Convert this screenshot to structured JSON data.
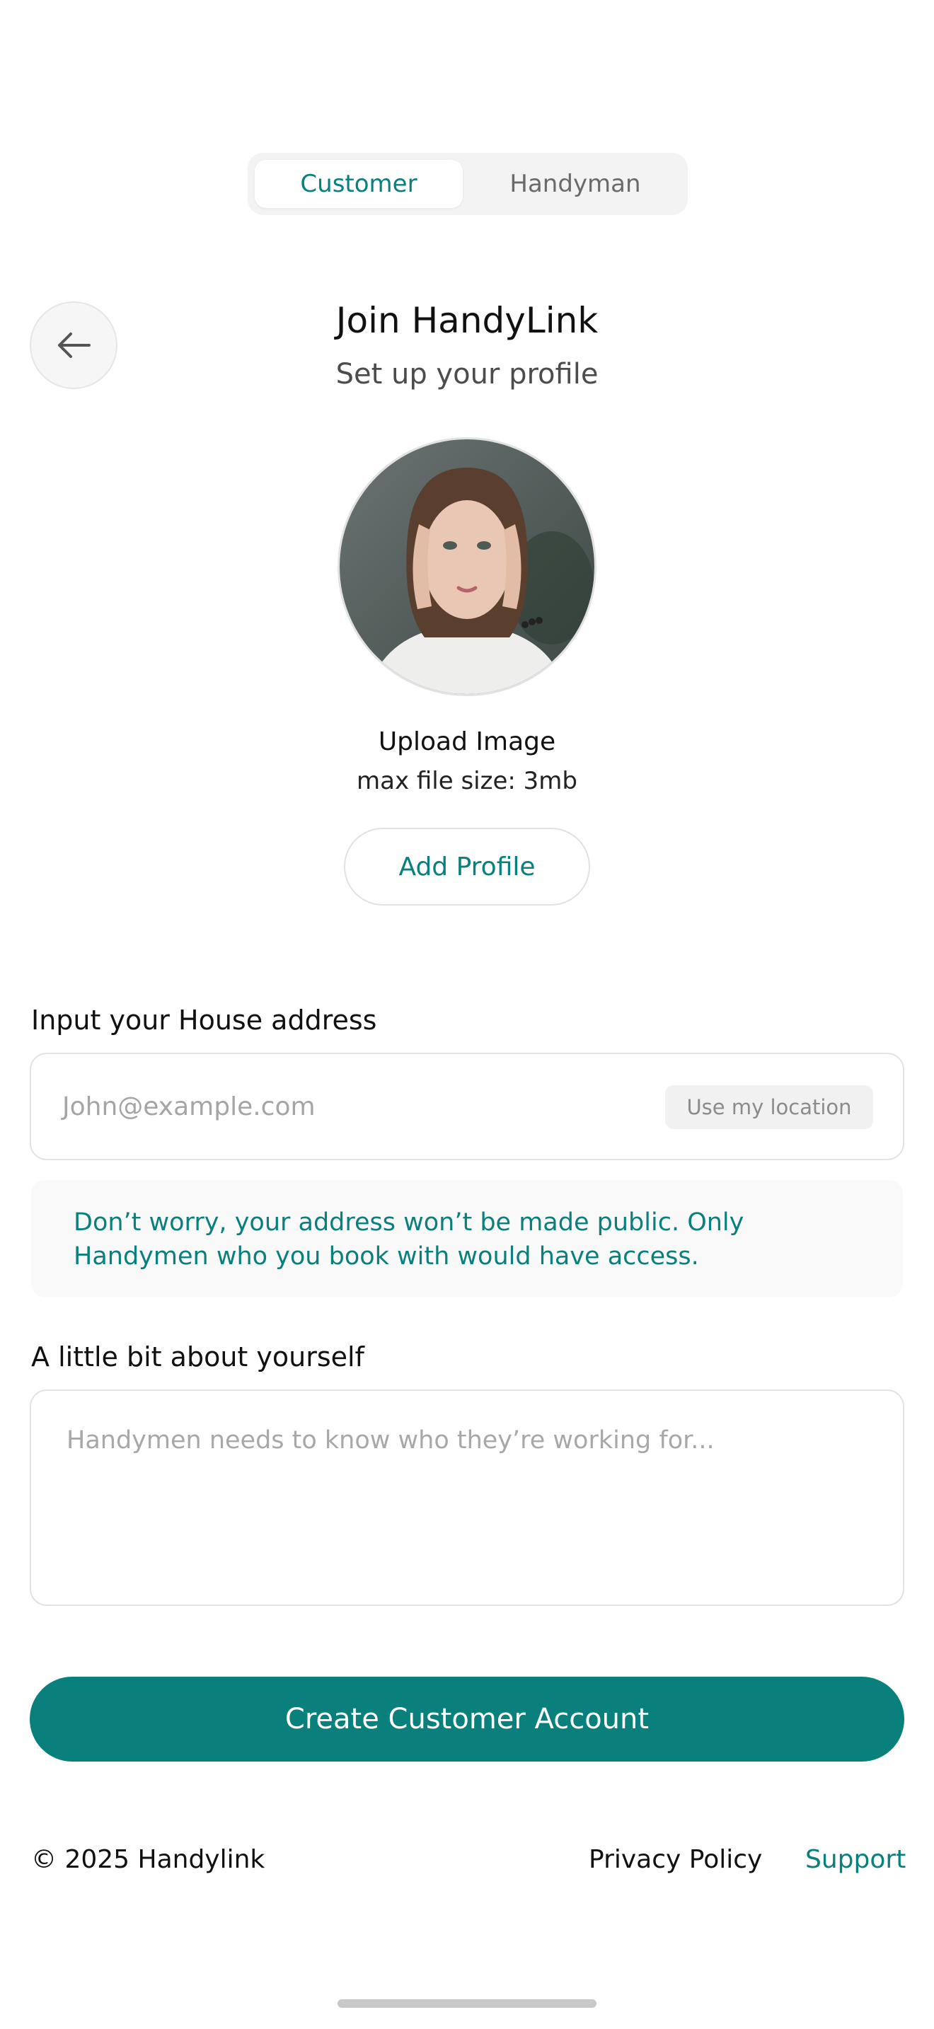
{
  "toggle": {
    "customer_label": "Customer",
    "handyman_label": "Handyman",
    "selected": "Customer"
  },
  "header": {
    "back_icon": "arrow-left-icon",
    "title": "Join HandyLink",
    "subtitle": "Set up your profile"
  },
  "profile": {
    "upload_label": "Upload Image",
    "file_size_note": "max file size: 3mb",
    "add_profile_label": "Add Profile"
  },
  "address": {
    "label": "Input your House address",
    "placeholder": "John@example.com",
    "use_location_label": "Use my location",
    "privacy_note": "Don’t worry, your address won’t be made public. Only Handymen who you book with would have access."
  },
  "about": {
    "label": "A little bit about yourself",
    "placeholder": "Handymen needs to know who they’re working for..."
  },
  "actions": {
    "create_label": "Create Customer Account"
  },
  "footer": {
    "copyright": "©  2025 Handylink",
    "privacy_label": "Privacy Policy",
    "support_label": "Support"
  },
  "colors": {
    "accent": "#0a807d",
    "text": "#141414",
    "muted": "#a5a5a5",
    "border": "#e3e3e3"
  }
}
